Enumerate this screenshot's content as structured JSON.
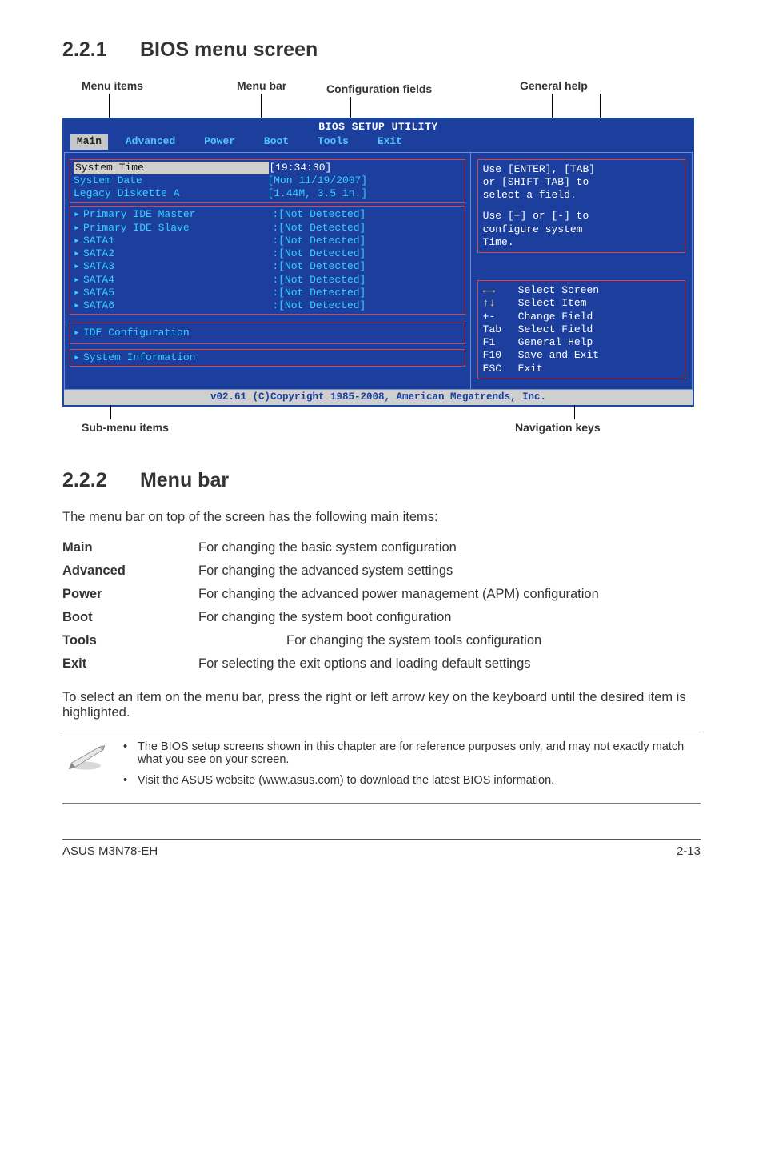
{
  "sections": {
    "s1": {
      "num": "2.2.1",
      "title": "BIOS menu screen"
    },
    "s2": {
      "num": "2.2.2",
      "title": "Menu bar"
    }
  },
  "diagram_labels": {
    "menu_items": "Menu items",
    "menu_bar": "Menu bar",
    "config_fields": "Configuration fields",
    "general_help": "General help",
    "submenu": "Sub-menu items",
    "nav_keys": "Navigation keys"
  },
  "bios": {
    "title": "BIOS SETUP UTILITY",
    "tabs": {
      "main": "Main",
      "advanced": "Advanced",
      "power": "Power",
      "boot": "Boot",
      "tools": "Tools",
      "exit": "Exit"
    },
    "left": {
      "sys_time_lbl": "System Time",
      "sys_time_val": "[19:34:30]",
      "sys_date_lbl": "System Date",
      "sys_date_val": "[Mon 11/19/2007]",
      "legacy_lbl": "Legacy Diskette A",
      "legacy_val": "[1.44M, 3.5 in.]",
      "rows": [
        {
          "lbl": "Primary IDE Master",
          "val": ":[Not Detected]"
        },
        {
          "lbl": "Primary IDE Slave",
          "val": ":[Not Detected]"
        },
        {
          "lbl": "SATA1",
          "val": ":[Not Detected]"
        },
        {
          "lbl": "SATA2",
          "val": ":[Not Detected]"
        },
        {
          "lbl": "SATA3",
          "val": ":[Not Detected]"
        },
        {
          "lbl": "SATA4",
          "val": ":[Not Detected]"
        },
        {
          "lbl": "SATA5",
          "val": ":[Not Detected]"
        },
        {
          "lbl": "SATA6",
          "val": ":[Not Detected]"
        }
      ],
      "ide_cfg": "IDE Configuration",
      "sys_info": "System Information"
    },
    "right": {
      "help1": "Use [ENTER], [TAB]",
      "help2": "or [SHIFT-TAB] to",
      "help3": "select a field.",
      "help4": "Use [+] or [-] to",
      "help5": "configure system",
      "help6": "Time.",
      "keys": [
        {
          "k": "←→",
          "d": "Select Screen",
          "arrow": true
        },
        {
          "k": "↑↓",
          "d": "Select Item",
          "arrow": true
        },
        {
          "k": "+-",
          "d": "Change Field"
        },
        {
          "k": "Tab",
          "d": "Select Field"
        },
        {
          "k": "F1",
          "d": "General Help"
        },
        {
          "k": "F10",
          "d": "Save and Exit"
        },
        {
          "k": "ESC",
          "d": "Exit"
        }
      ]
    },
    "footer": "v02.61 (C)Copyright 1985-2008, American Megatrends, Inc."
  },
  "menubar_intro": "The menu bar on top of the screen has the following main items:",
  "defs": {
    "Main": "For changing the basic system configuration",
    "Advanced": "For changing the advanced system settings",
    "Power": "For changing the advanced power management (APM) configuration",
    "Boot": "For changing the system boot configuration",
    "Tools": "For changing the system tools configuration",
    "Exit": "For selecting the exit options and loading default settings"
  },
  "para2": "To select an item on the menu bar, press the right or left arrow key on the keyboard until the desired item is highlighted.",
  "notes": {
    "n1": "The BIOS setup screens shown in this chapter are for reference purposes only, and may not exactly match what you see on your screen.",
    "n2": "Visit the ASUS website (www.asus.com) to download the latest BIOS information."
  },
  "footer": {
    "left": "ASUS M3N78-EH",
    "right": "2-13"
  }
}
